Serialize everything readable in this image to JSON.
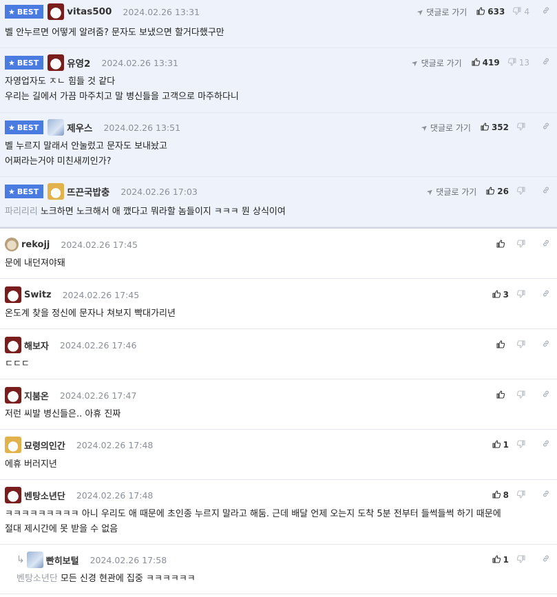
{
  "best_label": "BEST",
  "goto_label": "댓글로 가기",
  "best_comments": [
    {
      "nick": "vitas500",
      "time": "2024.02.26 13:31",
      "up": "633",
      "down": "4",
      "lines": [
        "벨 안누르면 어떻게 알려줌? 문자도 보냈으면 할거다했구만"
      ],
      "avatar": "dog",
      "ref": ""
    },
    {
      "nick": "유영2",
      "time": "2024.02.26 13:31",
      "up": "419",
      "down": "13",
      "lines": [
        "자영업자도 ㅈㄴ 힘들 것 같다",
        "우리는 길에서 가끔 마주치고 말 병신들을 고객으로 마주하다니"
      ],
      "avatar": "dog",
      "ref": ""
    },
    {
      "nick": "제우스",
      "time": "2024.02.26 13:51",
      "up": "352",
      "down": "",
      "lines": [
        "벨 누르지 말래서 안눌렀고 문자도 보내놨고",
        "어쩌라는거야 미친새끼인가?"
      ],
      "avatar": "wolf",
      "ref": ""
    },
    {
      "nick": "뜨끈국밥충",
      "time": "2024.02.26 17:03",
      "up": "26",
      "down": "",
      "lines": [
        "노크하면 노크해서 애 깼다고 뭐라할 놈들이지 ㅋㅋㅋ 뭔 상식이여"
      ],
      "avatar": "cat",
      "ref": "파리리리"
    }
  ],
  "comments": [
    {
      "nick": "rekojj",
      "time": "2024.02.26 17:45",
      "up": "",
      "lines": [
        "문에 내던져야돼"
      ],
      "avatar": "blob",
      "ref": ""
    },
    {
      "nick": "Switz",
      "time": "2024.02.26 17:45",
      "up": "3",
      "lines": [
        "온도계 찾을 정신에 문자나 쳐보지 빡대가리년"
      ],
      "avatar": "dog",
      "ref": ""
    },
    {
      "nick": "해보자",
      "time": "2024.02.26 17:46",
      "up": "",
      "lines": [
        "ㄷㄷㄷ"
      ],
      "avatar": "dog",
      "ref": ""
    },
    {
      "nick": "지붐온",
      "time": "2024.02.26 17:47",
      "up": "",
      "lines": [
        "저런 씨발 병신들은.. 아휴 진짜"
      ],
      "avatar": "dog",
      "ref": ""
    },
    {
      "nick": "묘령의인간",
      "time": "2024.02.26 17:48",
      "up": "1",
      "lines": [
        "에휴 버러지년"
      ],
      "avatar": "cat",
      "ref": ""
    },
    {
      "nick": "벤탕소년단",
      "time": "2024.02.26 17:48",
      "up": "8",
      "lines": [
        "ㅋㅋㅋㅋㅋㅋㅋㅋㅋ 아니 우리도 애 때문에 초인종 누르지 말라고 해둠. 근데 배달 언제 오는지 도착 5분 전부터 들썩들썩 하기 때문에",
        "절대 제시간에 못 받을 수 없음"
      ],
      "avatar": "dog",
      "ref": ""
    }
  ],
  "reply": {
    "nick": "빤히보털",
    "time": "2024.02.26 17:58",
    "up": "1",
    "lines": [
      "모든 신경 현관에 집중 ㅋㅋㅋㅋㅋㅋ"
    ],
    "avatar": "wolf",
    "ref": "벤탕소년단"
  },
  "colors": {
    "best_bg": "#eef2fa",
    "badge": "#4a7be0",
    "border": "#e3e6ec"
  },
  "icons": {
    "thumb_up": "thumbs-up-icon",
    "thumb_down": "thumbs-down-icon",
    "link": "link-icon",
    "send": "send-arrow-icon",
    "star": "star-icon",
    "reply": "reply-arrow-icon"
  }
}
